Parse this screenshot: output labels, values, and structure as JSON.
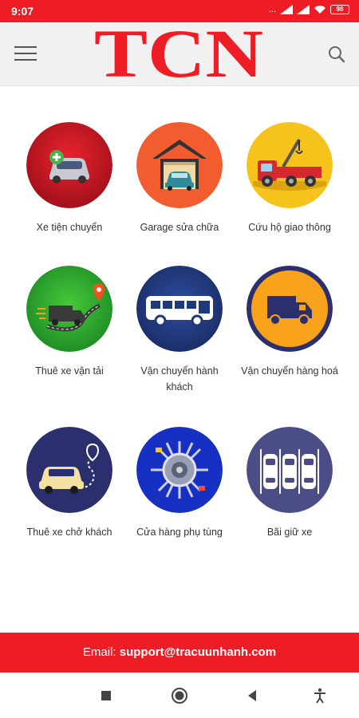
{
  "status_bar": {
    "time": "9:07",
    "more": "...",
    "battery": "98"
  },
  "header": {
    "logo_text": "TCN"
  },
  "services": [
    {
      "label": "Xe tiện chuyển"
    },
    {
      "label": "Garage sửa chữa"
    },
    {
      "label": "Cứu hộ giao thông"
    },
    {
      "label": "Thuê xe vận tải"
    },
    {
      "label": "Vận chuyển hành khách"
    },
    {
      "label": "Vận chuyển hàng hoá"
    },
    {
      "label": "Thuê xe chở khách"
    },
    {
      "label": "Cửa hàng phụ tùng"
    },
    {
      "label": "Bãi giữ xe"
    }
  ],
  "footer": {
    "email_label": "Email: ",
    "email": "support@tracuunhanh.com"
  },
  "colors": {
    "brand_red": "#ee1c24",
    "navy": "#2b2f6e"
  }
}
